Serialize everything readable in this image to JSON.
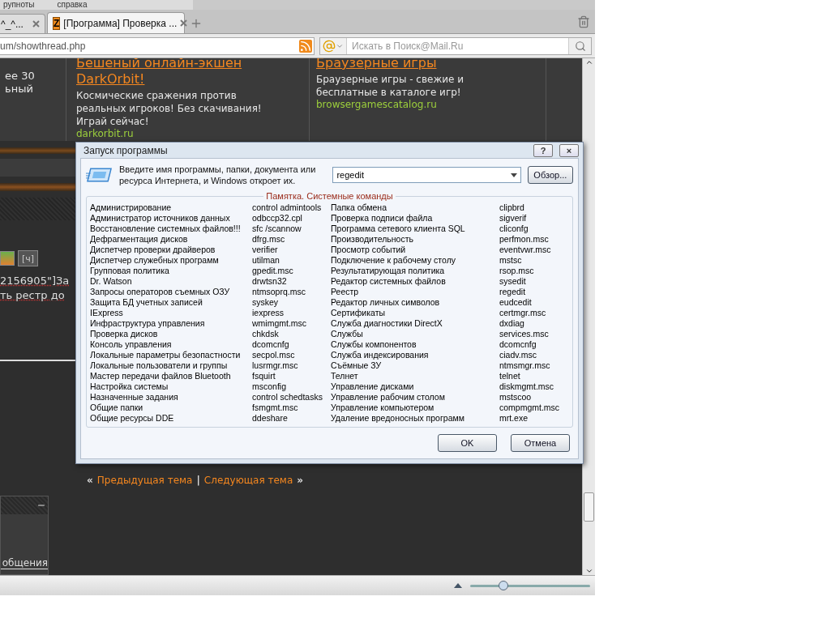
{
  "menu": [
    "рупноты",
    "справка"
  ],
  "tabs": [
    {
      "label": "^_^...",
      "selected": false
    },
    {
      "label": "[Программа] Проверка ...",
      "selected": true,
      "icon_text": "Z"
    }
  ],
  "address": {
    "url": "um/showthread.php"
  },
  "search": {
    "placeholder": "Искать в Поиск@Mail.Ru"
  },
  "page": {
    "left_ad_lines": [
      "ее 30",
      "ьный"
    ],
    "ads": [
      {
        "title_lines": [
          "Бешеный онлайн-экшен",
          "DarkOrbit!"
        ],
        "text": "Космические сражения против реальных игроков! Без скачивания! Играй сейчас!",
        "url": "darkorbit.ru"
      },
      {
        "title_lines": [
          "Браузерные игры"
        ],
        "text": "Браузерные игры - свежие и бесплатные в каталоге игр!",
        "url": "browsergamescatalog.ru"
      }
    ],
    "toolbar_button": "[ч]",
    "post_lines": [
      "2156905\"]За",
      "ть рестр до"
    ],
    "nav": {
      "prev_mark": "«",
      "prev": "Предыдущая тема",
      "separator": "|",
      "next": "Следующая тема",
      "next_mark": "»"
    },
    "panel_text": "общения"
  },
  "dialog": {
    "title": "Запуск программы",
    "help": "?",
    "close": "×",
    "prompt": "Введите имя программы, папки, документа или ресурса Интернета, и Windows откроет их.",
    "value": "regedit",
    "browse": "Обзор...",
    "group_title": "Памятка. Системные команды",
    "columns": [
      [
        {
          "name": "Администрирование",
          "command": "control admintools"
        },
        {
          "name": "Администратор источников данных",
          "command": "odbccp32.cpl"
        },
        {
          "name": "Восстановление системных файлов!!!",
          "command": "sfc /scannow"
        },
        {
          "name": "Дефрагментация дисков",
          "command": "dfrg.msc"
        },
        {
          "name": "Диспетчер проверки драйверов",
          "command": "verifier"
        },
        {
          "name": "Диспетчер служебных программ",
          "command": "utilman"
        },
        {
          "name": "Групповая политика",
          "command": "gpedit.msc"
        },
        {
          "name": "Dr. Watson",
          "command": "drwtsn32"
        },
        {
          "name": "Запросы операторов съемных ОЗУ",
          "command": "ntmsoprq.msc"
        },
        {
          "name": "Защита БД учетных записей",
          "command": "syskey"
        },
        {
          "name": "IExpress",
          "command": "iexpress"
        },
        {
          "name": "Инфраструктура управления",
          "command": "wmimgmt.msc"
        },
        {
          "name": "Проверка дисков",
          "command": "chkdsk"
        },
        {
          "name": "Консоль управления",
          "command": "dcomcnfg"
        },
        {
          "name": "Локальные параметры безопастности",
          "command": "secpol.msc"
        },
        {
          "name": "Локальные пользователи и группы",
          "command": "lusrmgr.msc"
        },
        {
          "name": "Мастер передачи файлов Bluetooth",
          "command": "fsquirt"
        },
        {
          "name": "Настройка системы",
          "command": "msconfig"
        },
        {
          "name": "Назначенные задания",
          "command": "control schedtasks"
        },
        {
          "name": "Общие папки",
          "command": "fsmgmt.msc"
        },
        {
          "name": "Общие ресурсы DDE",
          "command": "ddeshare"
        }
      ],
      [
        {
          "name": "Папка обмена",
          "command": "clipbrd"
        },
        {
          "name": "Проверка подписи файла",
          "command": "sigverif"
        },
        {
          "name": "Программа сетевого клиента SQL",
          "command": "cliconfg"
        },
        {
          "name": "Производительность",
          "command": "perfmon.msc"
        },
        {
          "name": "Просмотр событий",
          "command": "eventvwr.msc"
        },
        {
          "name": "Подключение к рабочему столу",
          "command": "mstsc"
        },
        {
          "name": "Результатирующая политика",
          "command": "rsop.msc"
        },
        {
          "name": "Редактор системных файлов",
          "command": "sysedit"
        },
        {
          "name": "Реестр",
          "command": "regedit"
        },
        {
          "name": "Редактор личных символов",
          "command": "eudcedit"
        },
        {
          "name": "Сертификаты",
          "command": "certmgr.msc"
        },
        {
          "name": "Служба диагностики DirectX",
          "command": "dxdiag"
        },
        {
          "name": "Службы",
          "command": "services.msc"
        },
        {
          "name": "Службы компонентов",
          "command": "dcomcnfg"
        },
        {
          "name": "Служба индексирования",
          "command": "ciadv.msc"
        },
        {
          "name": "Съёмные ЗУ",
          "command": "ntmsmgr.msc"
        },
        {
          "name": "Телнет",
          "command": "telnet"
        },
        {
          "name": "Управление дисками",
          "command": "diskmgmt.msc"
        },
        {
          "name": "Управление рабочим столом",
          "command": "mstscoo"
        },
        {
          "name": "Управление компьютером",
          "command": "compmgmt.msc"
        },
        {
          "name": "Удаление вредоносных программ",
          "command": "mrt.exe"
        }
      ]
    ],
    "buttons": [
      "OK",
      "Отмена"
    ]
  },
  "status_bar": {
    "zoom": {
      "level": 0.28
    }
  }
}
